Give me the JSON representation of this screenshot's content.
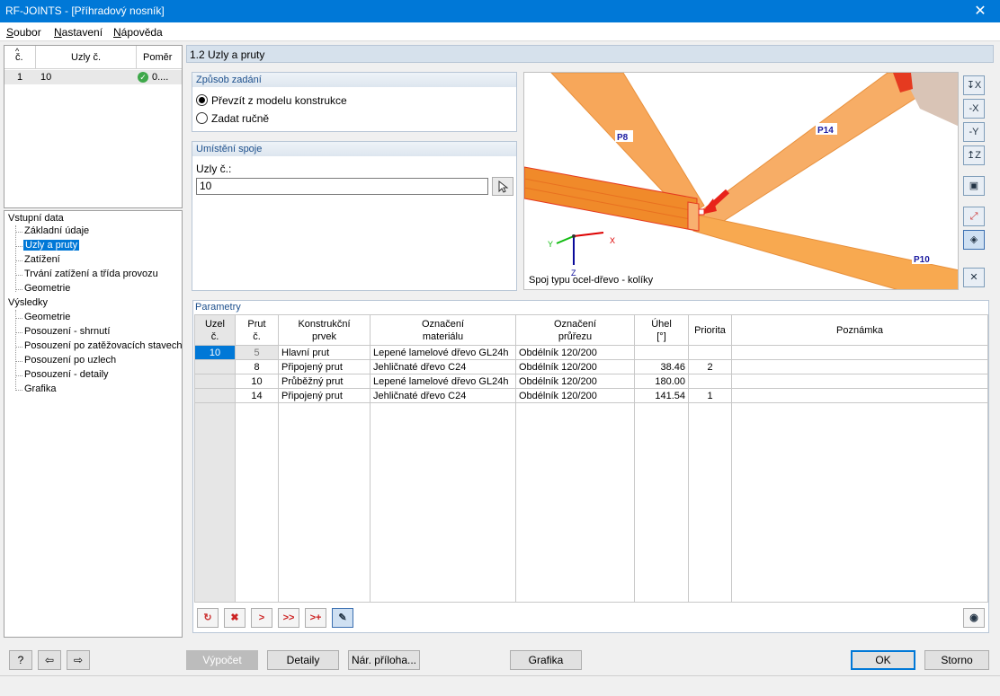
{
  "window": {
    "title": "RF-JOINTS - [Příhradový nosník]",
    "close_glyph": "✕"
  },
  "menu": {
    "items": [
      {
        "u": "S",
        "rest": "oubor"
      },
      {
        "u": "N",
        "rest": "astavení"
      },
      {
        "u": "N",
        "rest": "ápověda"
      }
    ]
  },
  "cases_table": {
    "headers": [
      "č.",
      "Uzly č.",
      "Poměr"
    ],
    "rows": [
      {
        "no": "1",
        "nodes": "10",
        "ratio": "0...."
      }
    ]
  },
  "nav": {
    "input_label": "Vstupní data",
    "input_items": [
      "Základní údaje",
      "Uzly a pruty",
      "Zatížení",
      "Trvání zatížení a třída provozu",
      "Geometrie"
    ],
    "results_label": "Výsledky",
    "result_items": [
      "Geometrie",
      "Posouzení - shrnutí",
      "Posouzení po zatěžovacích stavech",
      "Posouzení po uzlech",
      "Posouzení - detaily",
      "Grafika"
    ]
  },
  "main": {
    "title": "1.2 Uzly a pruty",
    "input_method": {
      "title": "Způsob zadání",
      "option1": "Převzít z modelu konstrukce",
      "option2": "Zadat ručně",
      "selected": "option1"
    },
    "joint_location": {
      "title": "Umístění spoje",
      "label": "Uzly č.:",
      "value": "10"
    },
    "view": {
      "labels": [
        "P8",
        "P14",
        "P10"
      ],
      "axes": [
        "X",
        "Y",
        "Z"
      ],
      "caption": "Spoj typu ocel-dřevo - kolíky"
    },
    "side_tools": [
      "view-x-icon",
      "view-minus-x-icon",
      "view-minus-y-icon",
      "view-z-icon",
      "iso-view-icon",
      "zoom-select-icon",
      "render-icon",
      "reset-view-icon"
    ]
  },
  "params": {
    "title": "Parametry",
    "headers": [
      [
        "Uzel",
        "č."
      ],
      [
        "Prut",
        "č."
      ],
      [
        "Konstrukční",
        "prvek"
      ],
      [
        "Označení",
        "materiálu"
      ],
      [
        "Označení",
        "průřezu"
      ],
      [
        "Úhel",
        "[°]"
      ],
      [
        "Priorita",
        ""
      ],
      [
        "Poznámka",
        ""
      ]
    ],
    "rows": [
      {
        "node": "10",
        "member": "5",
        "element": "Hlavní prut",
        "material": "Lepené lamelové dřevo GL24h",
        "section": "Obdélník 120/200",
        "angle": "",
        "priority": "",
        "note": ""
      },
      {
        "node": "",
        "member": "8",
        "element": "Připojený prut",
        "material": "Jehličnaté dřevo C24",
        "section": "Obdélník 120/200",
        "angle": "38.46",
        "priority": "2",
        "note": ""
      },
      {
        "node": "",
        "member": "10",
        "element": "Průběžný prut",
        "material": "Lepené lamelové dřevo GL24h",
        "section": "Obdélník 120/200",
        "angle": "180.00",
        "priority": "",
        "note": ""
      },
      {
        "node": "",
        "member": "14",
        "element": "Připojený prut",
        "material": "Jehličnaté dřevo C24",
        "section": "Obdélník 120/200",
        "angle": "141.54",
        "priority": "1",
        "note": ""
      }
    ]
  },
  "buttons": {
    "calc": "Výpočet",
    "details": "Detaily",
    "annex": "Nár. příloha...",
    "graphics": "Grafika",
    "ok": "OK",
    "cancel": "Storno"
  },
  "colors": {
    "accent": "#0078d7",
    "timber": "#f5a64a",
    "timber_dark": "#e07a20",
    "highlight": "#e8231a"
  }
}
